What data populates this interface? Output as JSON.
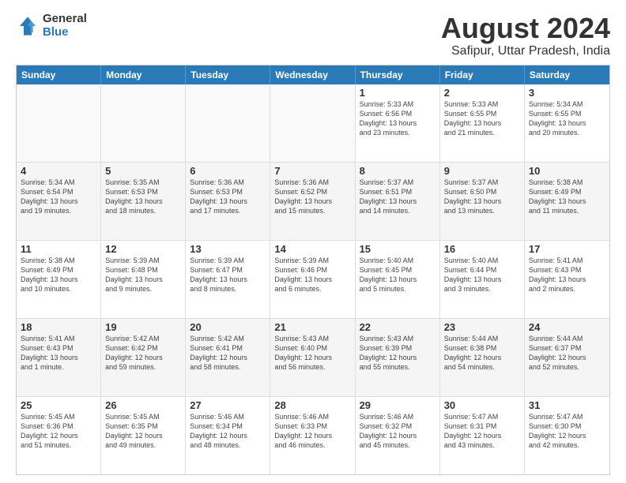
{
  "logo": {
    "general": "General",
    "blue": "Blue"
  },
  "title": "August 2024",
  "subtitle": "Safipur, Uttar Pradesh, India",
  "header_days": [
    "Sunday",
    "Monday",
    "Tuesday",
    "Wednesday",
    "Thursday",
    "Friday",
    "Saturday"
  ],
  "weeks": [
    [
      {
        "day": "",
        "text": "",
        "empty": true
      },
      {
        "day": "",
        "text": "",
        "empty": true
      },
      {
        "day": "",
        "text": "",
        "empty": true
      },
      {
        "day": "",
        "text": "",
        "empty": true
      },
      {
        "day": "1",
        "text": "Sunrise: 5:33 AM\nSunset: 6:56 PM\nDaylight: 13 hours\nand 23 minutes."
      },
      {
        "day": "2",
        "text": "Sunrise: 5:33 AM\nSunset: 6:55 PM\nDaylight: 13 hours\nand 21 minutes."
      },
      {
        "day": "3",
        "text": "Sunrise: 5:34 AM\nSunset: 6:55 PM\nDaylight: 13 hours\nand 20 minutes."
      }
    ],
    [
      {
        "day": "4",
        "text": "Sunrise: 5:34 AM\nSunset: 6:54 PM\nDaylight: 13 hours\nand 19 minutes."
      },
      {
        "day": "5",
        "text": "Sunrise: 5:35 AM\nSunset: 6:53 PM\nDaylight: 13 hours\nand 18 minutes."
      },
      {
        "day": "6",
        "text": "Sunrise: 5:36 AM\nSunset: 6:53 PM\nDaylight: 13 hours\nand 17 minutes."
      },
      {
        "day": "7",
        "text": "Sunrise: 5:36 AM\nSunset: 6:52 PM\nDaylight: 13 hours\nand 15 minutes."
      },
      {
        "day": "8",
        "text": "Sunrise: 5:37 AM\nSunset: 6:51 PM\nDaylight: 13 hours\nand 14 minutes."
      },
      {
        "day": "9",
        "text": "Sunrise: 5:37 AM\nSunset: 6:50 PM\nDaylight: 13 hours\nand 13 minutes."
      },
      {
        "day": "10",
        "text": "Sunrise: 5:38 AM\nSunset: 6:49 PM\nDaylight: 13 hours\nand 11 minutes."
      }
    ],
    [
      {
        "day": "11",
        "text": "Sunrise: 5:38 AM\nSunset: 6:49 PM\nDaylight: 13 hours\nand 10 minutes."
      },
      {
        "day": "12",
        "text": "Sunrise: 5:39 AM\nSunset: 6:48 PM\nDaylight: 13 hours\nand 9 minutes."
      },
      {
        "day": "13",
        "text": "Sunrise: 5:39 AM\nSunset: 6:47 PM\nDaylight: 13 hours\nand 8 minutes."
      },
      {
        "day": "14",
        "text": "Sunrise: 5:39 AM\nSunset: 6:46 PM\nDaylight: 13 hours\nand 6 minutes."
      },
      {
        "day": "15",
        "text": "Sunrise: 5:40 AM\nSunset: 6:45 PM\nDaylight: 13 hours\nand 5 minutes."
      },
      {
        "day": "16",
        "text": "Sunrise: 5:40 AM\nSunset: 6:44 PM\nDaylight: 13 hours\nand 3 minutes."
      },
      {
        "day": "17",
        "text": "Sunrise: 5:41 AM\nSunset: 6:43 PM\nDaylight: 13 hours\nand 2 minutes."
      }
    ],
    [
      {
        "day": "18",
        "text": "Sunrise: 5:41 AM\nSunset: 6:43 PM\nDaylight: 13 hours\nand 1 minute."
      },
      {
        "day": "19",
        "text": "Sunrise: 5:42 AM\nSunset: 6:42 PM\nDaylight: 12 hours\nand 59 minutes."
      },
      {
        "day": "20",
        "text": "Sunrise: 5:42 AM\nSunset: 6:41 PM\nDaylight: 12 hours\nand 58 minutes."
      },
      {
        "day": "21",
        "text": "Sunrise: 5:43 AM\nSunset: 6:40 PM\nDaylight: 12 hours\nand 56 minutes."
      },
      {
        "day": "22",
        "text": "Sunrise: 5:43 AM\nSunset: 6:39 PM\nDaylight: 12 hours\nand 55 minutes."
      },
      {
        "day": "23",
        "text": "Sunrise: 5:44 AM\nSunset: 6:38 PM\nDaylight: 12 hours\nand 54 minutes."
      },
      {
        "day": "24",
        "text": "Sunrise: 5:44 AM\nSunset: 6:37 PM\nDaylight: 12 hours\nand 52 minutes."
      }
    ],
    [
      {
        "day": "25",
        "text": "Sunrise: 5:45 AM\nSunset: 6:36 PM\nDaylight: 12 hours\nand 51 minutes."
      },
      {
        "day": "26",
        "text": "Sunrise: 5:45 AM\nSunset: 6:35 PM\nDaylight: 12 hours\nand 49 minutes."
      },
      {
        "day": "27",
        "text": "Sunrise: 5:46 AM\nSunset: 6:34 PM\nDaylight: 12 hours\nand 48 minutes."
      },
      {
        "day": "28",
        "text": "Sunrise: 5:46 AM\nSunset: 6:33 PM\nDaylight: 12 hours\nand 46 minutes."
      },
      {
        "day": "29",
        "text": "Sunrise: 5:46 AM\nSunset: 6:32 PM\nDaylight: 12 hours\nand 45 minutes."
      },
      {
        "day": "30",
        "text": "Sunrise: 5:47 AM\nSunset: 6:31 PM\nDaylight: 12 hours\nand 43 minutes."
      },
      {
        "day": "31",
        "text": "Sunrise: 5:47 AM\nSunset: 6:30 PM\nDaylight: 12 hours\nand 42 minutes."
      }
    ]
  ]
}
